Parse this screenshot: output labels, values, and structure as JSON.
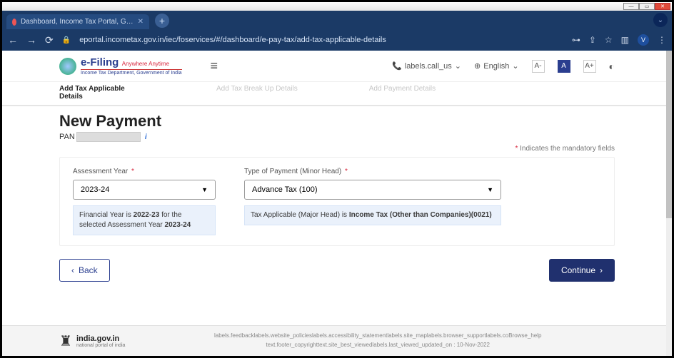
{
  "window": {
    "tab_title": "Dashboard, Income Tax Portal, G…",
    "url": "eportal.incometax.gov.in/iec/foservices/#/dashboard/e-pay-tax/add-tax-applicable-details",
    "user_initial": "V"
  },
  "header": {
    "brand": "e-Filing",
    "tagline": "Anywhere Anytime",
    "dept": "Income Tax Department, Government of India",
    "call_label": "labels.call_us",
    "language": "English",
    "font_minus": "A-",
    "font_normal": "A",
    "font_plus": "A+"
  },
  "breadcrumb": {
    "c1": "Add Tax Applicable Details",
    "c2": "Add Tax Break Up Details",
    "c3": "Add Payment Details"
  },
  "page": {
    "title": "New Payment",
    "pan_label": "PAN",
    "mandatory_note": "Indicates the mandatory fields",
    "assessment_label": "Assessment Year",
    "assessment_value": "2023-24",
    "assessment_hint_pre": "Financial Year is ",
    "assessment_hint_fy": "2022-23",
    "assessment_hint_mid": " for the selected Assessment Year ",
    "assessment_hint_ay": "2023-24",
    "type_label": "Type of Payment (Minor Head)",
    "type_value": "Advance Tax (100)",
    "type_hint_pre": "Tax Applicable (Major Head) is ",
    "type_hint_bold": "Income Tax (Other than Companies)(0021)",
    "back_label": "Back",
    "continue_label": "Continue"
  },
  "footer": {
    "india": "india.gov.in",
    "natl": "national portal of india",
    "line1": "labels.feedbacklabels.website_policieslabels.accessibility_statementlabels.site_maplabels.browser_supportlabels.coBrowse_help",
    "line2": "text.footer_copyrighttext.site_best_viewedlabels.last_viewed_updated_on : 10-Nov-2022"
  }
}
